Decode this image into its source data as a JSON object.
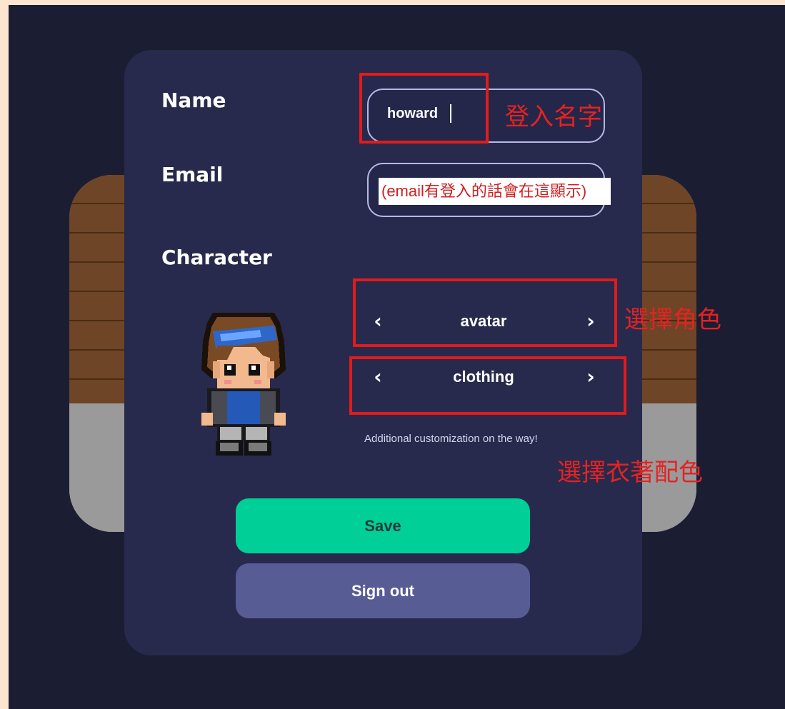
{
  "form": {
    "name_label": "Name",
    "name_value": "howard",
    "email_label": "Email",
    "email_display": "(email有登入的話會在這顯示)",
    "character_label": "Character",
    "avatar_selector": {
      "label": "avatar",
      "prev_icon": "chevron-left-icon",
      "next_icon": "chevron-right-icon"
    },
    "clothing_selector": {
      "label": "clothing",
      "prev_icon": "chevron-left-icon",
      "next_icon": "chevron-right-icon"
    },
    "note": "Additional customization on the way!",
    "save_label": "Save",
    "signout_label": "Sign out"
  },
  "annotations": {
    "name": "登入名字",
    "avatar": "選擇角色",
    "clothing": "選擇衣著配色"
  },
  "colors": {
    "page_bg": "#fde5cf",
    "app_bg": "#1b1d33",
    "card_bg": "#272a4c",
    "save_button": "#00cf98",
    "signout_button": "#575c94",
    "annotation_red": "#e21b1b"
  }
}
